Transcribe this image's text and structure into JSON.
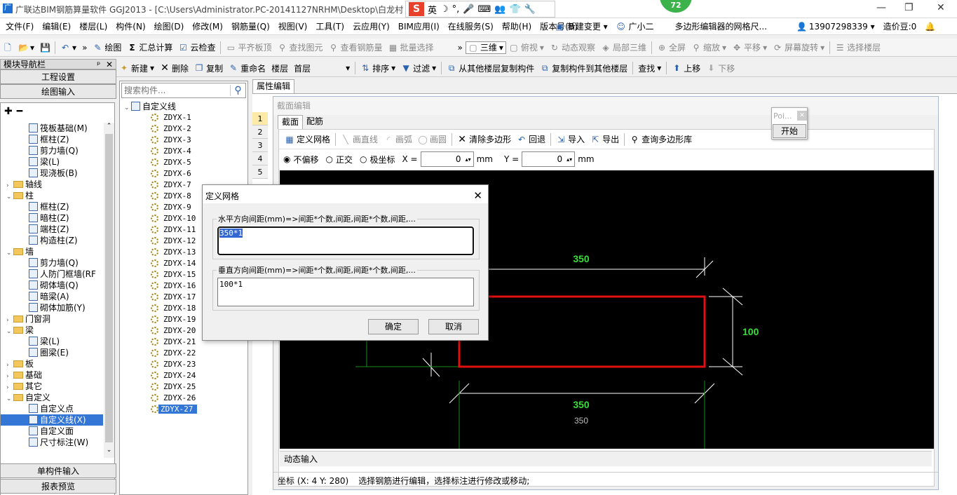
{
  "window": {
    "title": "广联达BIM钢筋算量软件 GGJ2013 - [C:\\Users\\Administrator.PC-20141127NRHM\\Desktop\\白龙村",
    "title_tail": "]",
    "icon": "app-icon"
  },
  "ime": {
    "logo": "S",
    "items": [
      "英",
      "☽",
      "°,",
      "🎤",
      "⌨",
      "👥",
      "👕",
      "🔧"
    ]
  },
  "badge": {
    "value": "72"
  },
  "menu": [
    "文件(F)",
    "编辑(E)",
    "楼层(L)",
    "构件(N)",
    "绘图(D)",
    "修改(M)",
    "钢筋量(Q)",
    "视图(V)",
    "工具(T)",
    "云应用(Y)",
    "BIM应用(I)",
    "在线服务(S)",
    "帮助(H)",
    "版本号(B)"
  ],
  "menu_right": {
    "new_change": "新建变更",
    "assistant": "广小二",
    "notice": "多边形编辑器的网格尺...",
    "phone": "13907298339",
    "beans": "造价豆:0"
  },
  "toolbar1": {
    "draw": "绘图",
    "sum": "汇总计算",
    "cloud_check": "云检查",
    "align_slab": "平齐板顶",
    "find": "查找图元",
    "view_rebar": "查看钢筋量",
    "batch": "批量选择",
    "view3d": "三维",
    "top_view": "俯视",
    "dynamic": "动态观察",
    "local3d": "局部三维",
    "fullscreen": "全屏",
    "zoom": "缩放",
    "pan": "平移",
    "rotate": "屏幕旋转",
    "select_floor": "选择楼层"
  },
  "toolbar2": {
    "new": "新建",
    "delete": "删除",
    "copy": "复制",
    "rename": "重命名",
    "floor_label": "楼层",
    "floor_value": "首层",
    "sort": "排序",
    "filter": "过滤",
    "copy_from": "从其他楼层复制构件",
    "copy_to": "复制构件到其他楼层",
    "search": "查找",
    "up": "上移",
    "down": "下移"
  },
  "nav": {
    "title": "模块导航栏",
    "pin": "ᵖ",
    "close": "✕",
    "project_settings": "工程设置",
    "draw_input": "绘图输入",
    "tree": [
      {
        "label": "筏板基础(M)",
        "level": 2,
        "type": "item"
      },
      {
        "label": "框柱(Z)",
        "level": 2,
        "type": "item"
      },
      {
        "label": "剪力墙(Q)",
        "level": 2,
        "type": "item"
      },
      {
        "label": "梁(L)",
        "level": 2,
        "type": "item"
      },
      {
        "label": "现浇板(B)",
        "level": 2,
        "type": "item"
      },
      {
        "label": "轴线",
        "level": 1,
        "type": "folder",
        "exp": "›"
      },
      {
        "label": "柱",
        "level": 1,
        "type": "folder",
        "exp": "⌄"
      },
      {
        "label": "框柱(Z)",
        "level": 2,
        "type": "item"
      },
      {
        "label": "暗柱(Z)",
        "level": 2,
        "type": "item"
      },
      {
        "label": "端柱(Z)",
        "level": 2,
        "type": "item"
      },
      {
        "label": "构造柱(Z)",
        "level": 2,
        "type": "item"
      },
      {
        "label": "墙",
        "level": 1,
        "type": "folder",
        "exp": "⌄"
      },
      {
        "label": "剪力墙(Q)",
        "level": 2,
        "type": "item"
      },
      {
        "label": "人防门框墙(RF",
        "level": 2,
        "type": "item"
      },
      {
        "label": "砌体墙(Q)",
        "level": 2,
        "type": "item"
      },
      {
        "label": "暗梁(A)",
        "level": 2,
        "type": "item"
      },
      {
        "label": "砌体加筋(Y)",
        "level": 2,
        "type": "item"
      },
      {
        "label": "门窗洞",
        "level": 1,
        "type": "folder",
        "exp": "›"
      },
      {
        "label": "梁",
        "level": 1,
        "type": "folder",
        "exp": "⌄"
      },
      {
        "label": "梁(L)",
        "level": 2,
        "type": "item"
      },
      {
        "label": "圈梁(E)",
        "level": 2,
        "type": "item"
      },
      {
        "label": "板",
        "level": 1,
        "type": "folder",
        "exp": "›"
      },
      {
        "label": "基础",
        "level": 1,
        "type": "folder",
        "exp": "›"
      },
      {
        "label": "其它",
        "level": 1,
        "type": "folder",
        "exp": "›"
      },
      {
        "label": "自定义",
        "level": 1,
        "type": "folder",
        "exp": "⌄"
      },
      {
        "label": "自定义点",
        "level": 2,
        "type": "item"
      },
      {
        "label": "自定义线(X)",
        "level": 2,
        "type": "item",
        "selected": true
      },
      {
        "label": "自定义面",
        "level": 2,
        "type": "item"
      },
      {
        "label": "尺寸标注(W)",
        "level": 2,
        "type": "item"
      }
    ],
    "single_input": "单构件输入",
    "report": "报表预览"
  },
  "components": {
    "search_placeholder": "搜索构件...",
    "root": "自定义线",
    "items": [
      "ZDYX-1",
      "ZDYX-2",
      "ZDYX-3",
      "ZDYX-4",
      "ZDYX-5",
      "ZDYX-6",
      "ZDYX-7",
      "ZDYX-8",
      "ZDYX-9",
      "ZDYX-10",
      "ZDYX-11",
      "ZDYX-12",
      "ZDYX-13",
      "ZDYX-14",
      "ZDYX-15",
      "ZDYX-16",
      "ZDYX-17",
      "ZDYX-18",
      "ZDYX-19",
      "ZDYX-20",
      "ZDYX-21",
      "ZDYX-22",
      "ZDYX-23",
      "ZDYX-24",
      "ZDYX-25",
      "ZDYX-26",
      "ZDYX-27"
    ],
    "selected": "ZDYX-27"
  },
  "props_tab": "属性编辑",
  "row_numbers": [
    "1",
    "2",
    "3",
    "4",
    "5"
  ],
  "section_editor": {
    "title": "截面编辑",
    "tabs": [
      "截面",
      "配筋"
    ],
    "tools": {
      "define_grid": "定义网格",
      "draw_line": "画直线",
      "draw_arc": "画弧",
      "draw_circle": "画圆",
      "clear_poly": "清除多边形",
      "undo": "回退",
      "import": "导入",
      "export": "导出",
      "query_lib": "查询多边形库"
    },
    "offset": {
      "none": "不偏移",
      "ortho": "正交",
      "polar": "极坐标",
      "x_label": "X =",
      "x_value": "0",
      "y_label": "Y =",
      "y_value": "0",
      "unit": "mm"
    },
    "dims": {
      "top": "350",
      "right": "100",
      "bottom": "350",
      "bottom2": "350"
    },
    "dynamic_input": "动态输入",
    "status_coord": "坐标 (X: 4 Y: 280)",
    "status_msg": "选择钢筋进行编辑，选择标注进行修改或移动;"
  },
  "popup": {
    "title": "Poi...",
    "start": "开始"
  },
  "dialog": {
    "title": "定义网格",
    "h_label": "水平方向间距(mm)=>间距*个数,间距,间距*个数,间距,...",
    "h_value": "350*1",
    "v_label": "垂直方向间距(mm)=>间距*个数,间距,间距*个数,间距,...",
    "v_value": "100*1",
    "ok": "确定",
    "cancel": "取消"
  }
}
